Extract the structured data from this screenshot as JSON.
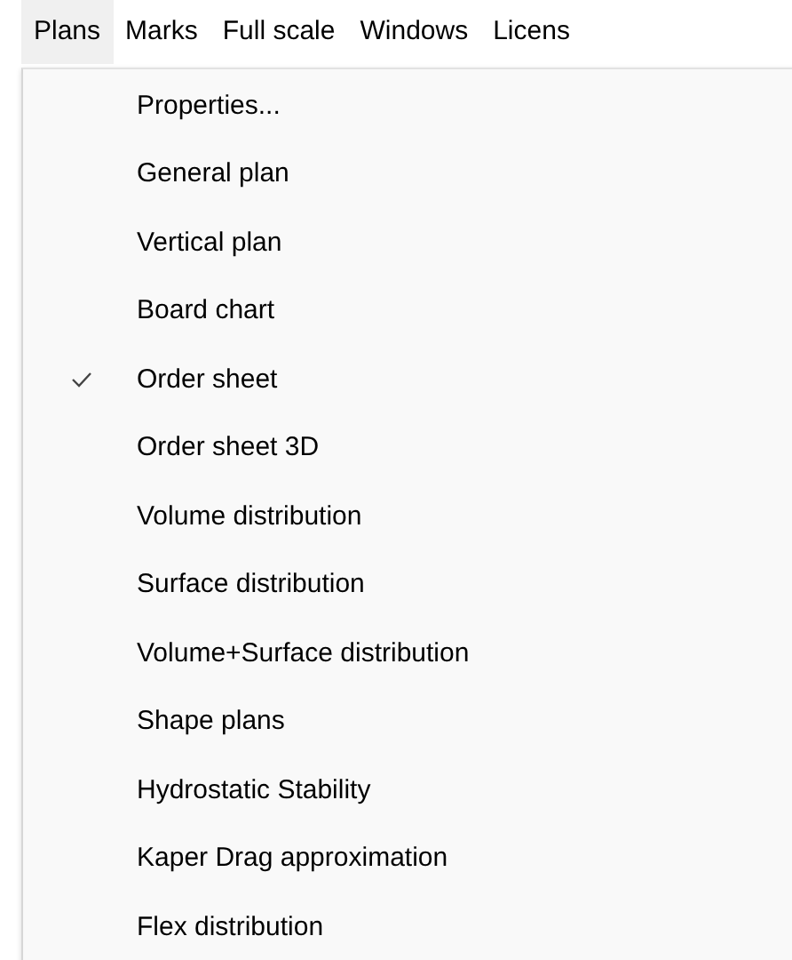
{
  "menu_bar": [
    {
      "label": "Plans",
      "selected": true
    },
    {
      "label": "Marks",
      "selected": false
    },
    {
      "label": "Full scale",
      "selected": false
    },
    {
      "label": "Windows",
      "selected": false
    },
    {
      "label": "Licens",
      "selected": false
    }
  ],
  "menu": {
    "items": [
      {
        "label": "Properties...",
        "checked": false
      },
      {
        "label": "General plan",
        "checked": false
      },
      {
        "label": "Vertical plan",
        "checked": false
      },
      {
        "label": "Board chart",
        "checked": false
      },
      {
        "label": "Order sheet",
        "checked": true
      },
      {
        "label": "Order sheet 3D",
        "checked": false
      },
      {
        "label": "Volume distribution",
        "checked": false
      },
      {
        "label": "Surface distribution",
        "checked": false
      },
      {
        "label": "Volume+Surface distribution",
        "checked": false
      },
      {
        "label": "Shape plans",
        "checked": false
      },
      {
        "label": "Hydrostatic Stability",
        "checked": false
      },
      {
        "label": "Kaper Drag approximation",
        "checked": false
      },
      {
        "label": "Flex distribution",
        "checked": false
      }
    ]
  }
}
